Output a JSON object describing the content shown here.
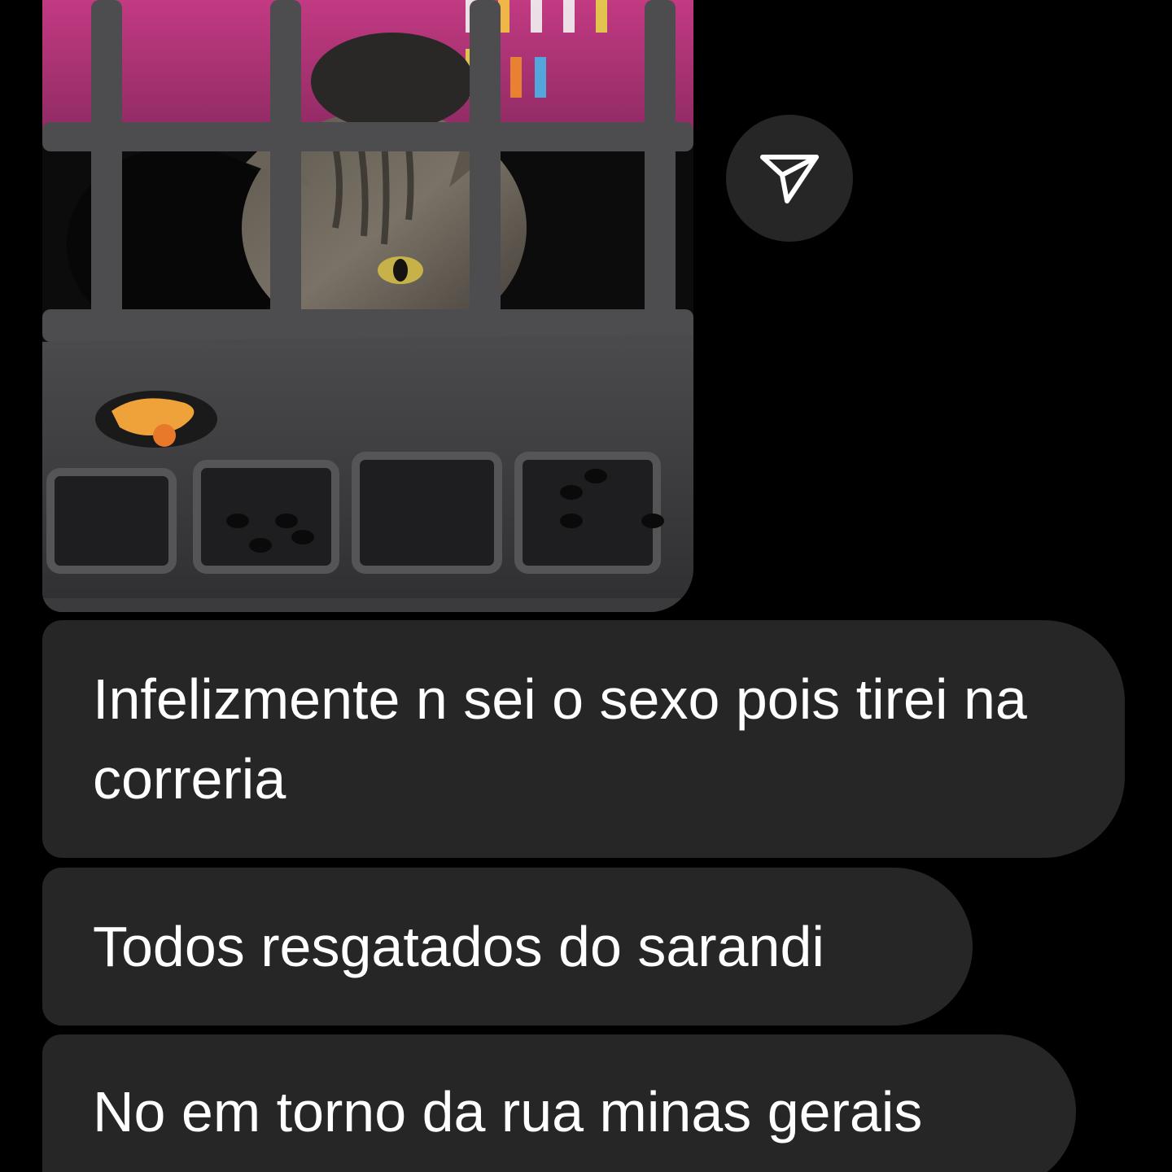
{
  "thread": {
    "photo_message": {
      "description_icon": "photo-attachment",
      "share_icon": "send-paper-plane-icon"
    },
    "messages": [
      {
        "text": "Infelizmente n sei o sexo pois tirei na correria"
      },
      {
        "text": "Todos resgatados do sarandi"
      },
      {
        "text": "No em torno da rua minas gerais"
      }
    ]
  },
  "colors": {
    "background": "#000000",
    "bubble": "#262626",
    "text": "#ffffff",
    "carrier_gray": "#4a4a4c",
    "carrier_magenta": "#b0306f"
  }
}
